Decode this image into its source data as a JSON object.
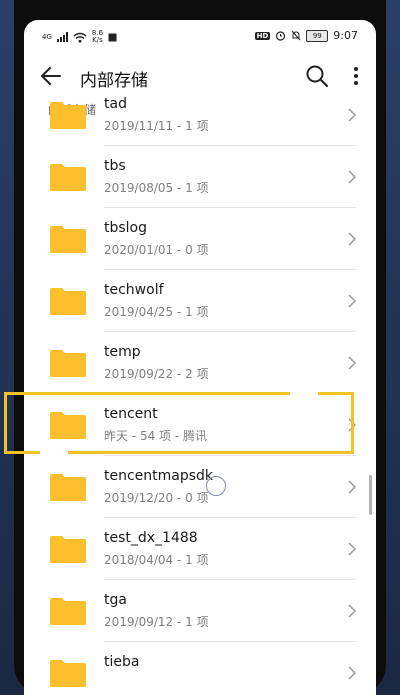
{
  "status": {
    "signal": "4G",
    "net_speed": "8.6",
    "net_unit": "K/s",
    "hd": "HD",
    "battery": "99",
    "time": "9:07"
  },
  "appbar": {
    "title": "内部存储"
  },
  "breadcrumb": "内部存储",
  "folders": [
    {
      "name": "tad",
      "meta": "2019/11/11 - 1 项"
    },
    {
      "name": "tbs",
      "meta": "2019/08/05 - 1 项"
    },
    {
      "name": "tbslog",
      "meta": "2020/01/01 - 0 项"
    },
    {
      "name": "techwolf",
      "meta": "2019/04/25 - 1 项"
    },
    {
      "name": "temp",
      "meta": "2019/09/22 - 2 项"
    },
    {
      "name": "tencent",
      "meta": "昨天 - 54 项 - 腾讯"
    },
    {
      "name": "tencentmapsdk",
      "meta": "2019/12/20 - 0 项"
    },
    {
      "name": "test_dx_1488",
      "meta": "2018/04/04 - 1 项"
    },
    {
      "name": "tga",
      "meta": "2019/09/12 - 1 项"
    },
    {
      "name": "tieba",
      "meta": ""
    }
  ],
  "colors": {
    "folder": "#fdbf2d",
    "highlight": "#f4c225"
  }
}
